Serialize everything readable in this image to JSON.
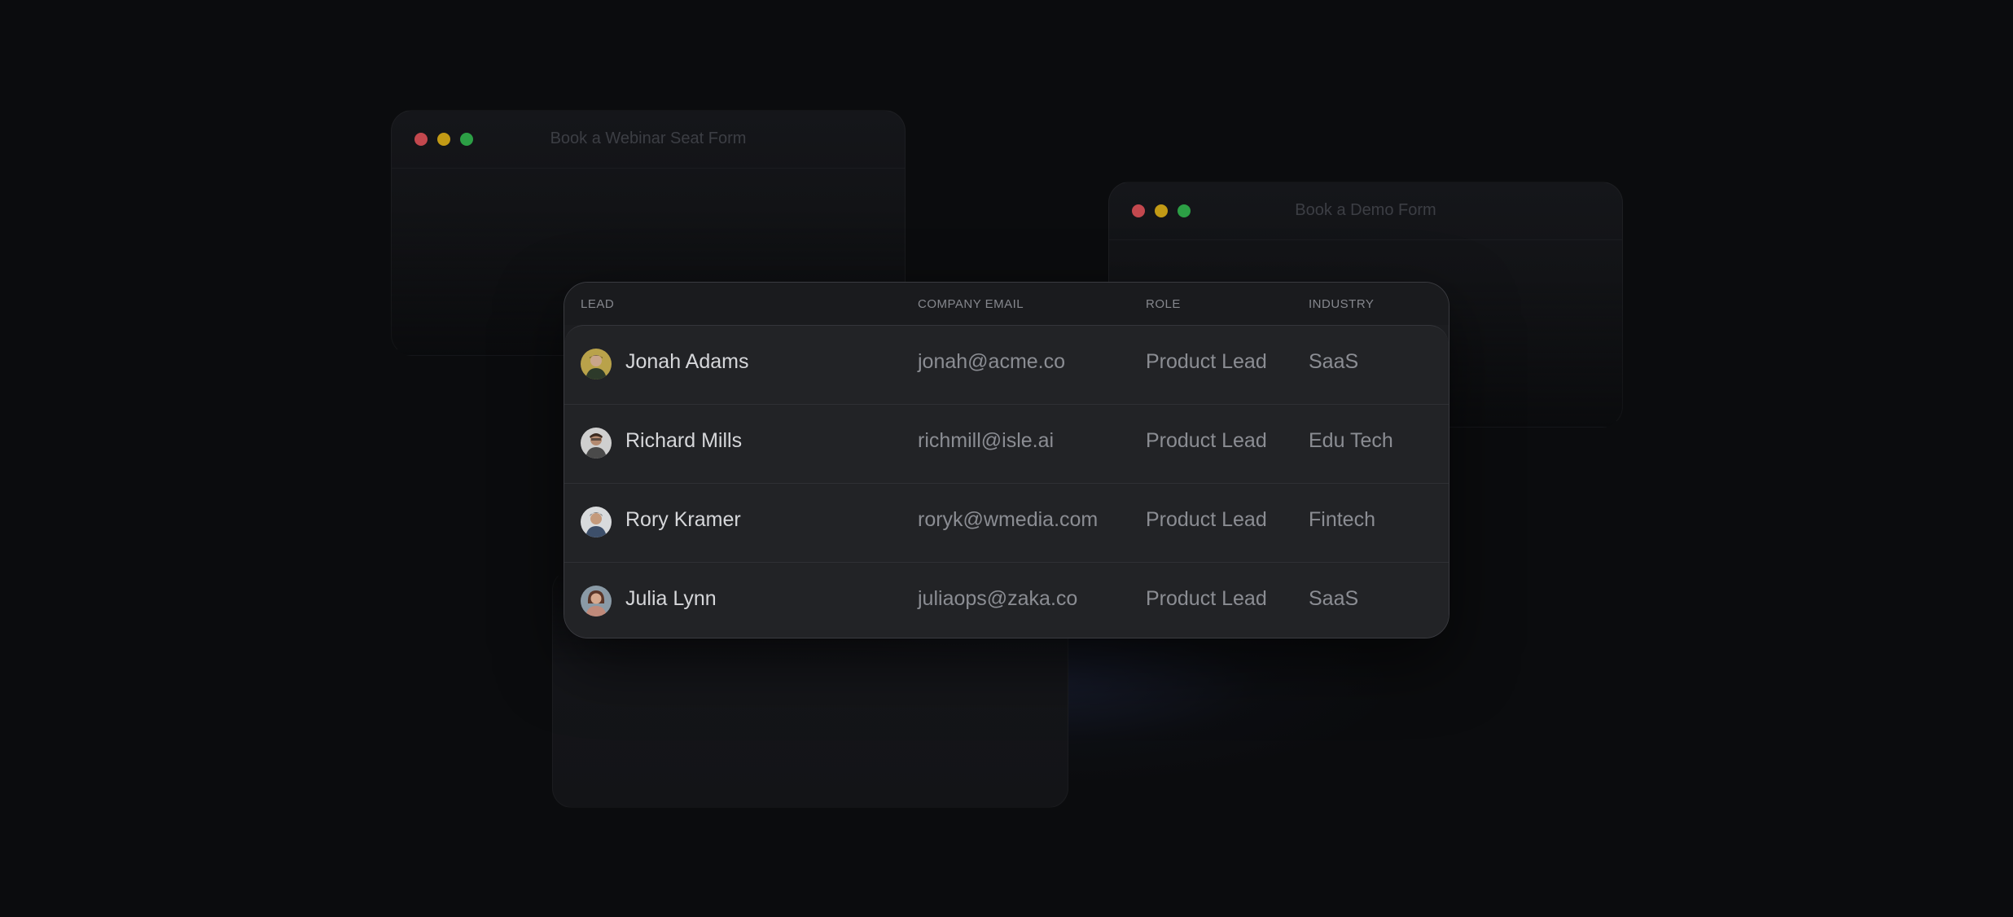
{
  "windows": {
    "webinar_title": "Book a Webinar Seat Form",
    "demo_title": "Book a Demo Form"
  },
  "table": {
    "headers": {
      "lead": "LEAD",
      "email": "COMPANY EMAIL",
      "role": "ROLE",
      "industry": "INDUSTRY"
    },
    "rows": [
      {
        "name": "Jonah Adams",
        "email": "jonah@acme.co",
        "role": "Product Lead",
        "industry": "SaaS"
      },
      {
        "name": "Richard Mills",
        "email": "richmill@isle.ai",
        "role": "Product Lead",
        "industry": "Edu Tech"
      },
      {
        "name": "Rory Kramer",
        "email": "roryk@wmedia.com",
        "role": "Product Lead",
        "industry": "Fintech"
      },
      {
        "name": "Julia Lynn",
        "email": "juliaops@zaka.co",
        "role": "Product Lead",
        "industry": "SaaS"
      }
    ]
  },
  "colors": {
    "background": "#0b0c0e",
    "card": "#1c1d20",
    "dot_red": "#c3484e",
    "dot_yellow": "#c29a15",
    "dot_green": "#2c9f45"
  },
  "icons": {
    "avatar": "user-avatar-photo"
  }
}
